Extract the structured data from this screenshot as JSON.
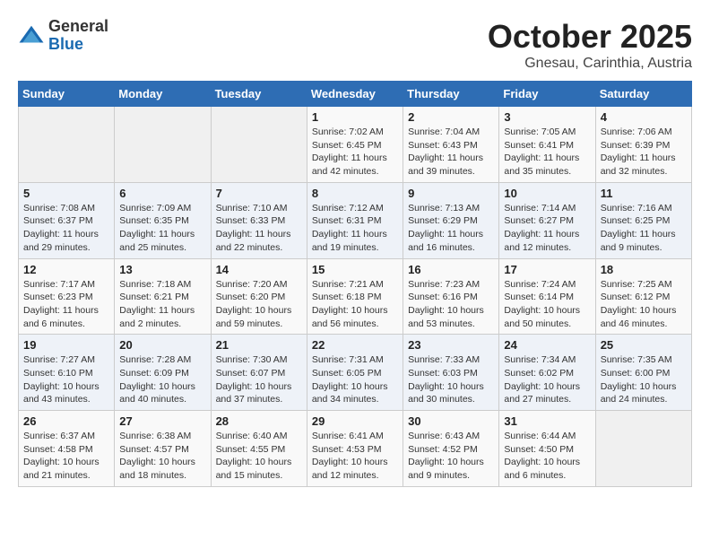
{
  "logo": {
    "general": "General",
    "blue": "Blue"
  },
  "header": {
    "month": "October 2025",
    "location": "Gnesau, Carinthia, Austria"
  },
  "days_of_week": [
    "Sunday",
    "Monday",
    "Tuesday",
    "Wednesday",
    "Thursday",
    "Friday",
    "Saturday"
  ],
  "weeks": [
    [
      {
        "day": "",
        "info": ""
      },
      {
        "day": "",
        "info": ""
      },
      {
        "day": "",
        "info": ""
      },
      {
        "day": "1",
        "info": "Sunrise: 7:02 AM\nSunset: 6:45 PM\nDaylight: 11 hours and 42 minutes."
      },
      {
        "day": "2",
        "info": "Sunrise: 7:04 AM\nSunset: 6:43 PM\nDaylight: 11 hours and 39 minutes."
      },
      {
        "day": "3",
        "info": "Sunrise: 7:05 AM\nSunset: 6:41 PM\nDaylight: 11 hours and 35 minutes."
      },
      {
        "day": "4",
        "info": "Sunrise: 7:06 AM\nSunset: 6:39 PM\nDaylight: 11 hours and 32 minutes."
      }
    ],
    [
      {
        "day": "5",
        "info": "Sunrise: 7:08 AM\nSunset: 6:37 PM\nDaylight: 11 hours and 29 minutes."
      },
      {
        "day": "6",
        "info": "Sunrise: 7:09 AM\nSunset: 6:35 PM\nDaylight: 11 hours and 25 minutes."
      },
      {
        "day": "7",
        "info": "Sunrise: 7:10 AM\nSunset: 6:33 PM\nDaylight: 11 hours and 22 minutes."
      },
      {
        "day": "8",
        "info": "Sunrise: 7:12 AM\nSunset: 6:31 PM\nDaylight: 11 hours and 19 minutes."
      },
      {
        "day": "9",
        "info": "Sunrise: 7:13 AM\nSunset: 6:29 PM\nDaylight: 11 hours and 16 minutes."
      },
      {
        "day": "10",
        "info": "Sunrise: 7:14 AM\nSunset: 6:27 PM\nDaylight: 11 hours and 12 minutes."
      },
      {
        "day": "11",
        "info": "Sunrise: 7:16 AM\nSunset: 6:25 PM\nDaylight: 11 hours and 9 minutes."
      }
    ],
    [
      {
        "day": "12",
        "info": "Sunrise: 7:17 AM\nSunset: 6:23 PM\nDaylight: 11 hours and 6 minutes."
      },
      {
        "day": "13",
        "info": "Sunrise: 7:18 AM\nSunset: 6:21 PM\nDaylight: 11 hours and 2 minutes."
      },
      {
        "day": "14",
        "info": "Sunrise: 7:20 AM\nSunset: 6:20 PM\nDaylight: 10 hours and 59 minutes."
      },
      {
        "day": "15",
        "info": "Sunrise: 7:21 AM\nSunset: 6:18 PM\nDaylight: 10 hours and 56 minutes."
      },
      {
        "day": "16",
        "info": "Sunrise: 7:23 AM\nSunset: 6:16 PM\nDaylight: 10 hours and 53 minutes."
      },
      {
        "day": "17",
        "info": "Sunrise: 7:24 AM\nSunset: 6:14 PM\nDaylight: 10 hours and 50 minutes."
      },
      {
        "day": "18",
        "info": "Sunrise: 7:25 AM\nSunset: 6:12 PM\nDaylight: 10 hours and 46 minutes."
      }
    ],
    [
      {
        "day": "19",
        "info": "Sunrise: 7:27 AM\nSunset: 6:10 PM\nDaylight: 10 hours and 43 minutes."
      },
      {
        "day": "20",
        "info": "Sunrise: 7:28 AM\nSunset: 6:09 PM\nDaylight: 10 hours and 40 minutes."
      },
      {
        "day": "21",
        "info": "Sunrise: 7:30 AM\nSunset: 6:07 PM\nDaylight: 10 hours and 37 minutes."
      },
      {
        "day": "22",
        "info": "Sunrise: 7:31 AM\nSunset: 6:05 PM\nDaylight: 10 hours and 34 minutes."
      },
      {
        "day": "23",
        "info": "Sunrise: 7:33 AM\nSunset: 6:03 PM\nDaylight: 10 hours and 30 minutes."
      },
      {
        "day": "24",
        "info": "Sunrise: 7:34 AM\nSunset: 6:02 PM\nDaylight: 10 hours and 27 minutes."
      },
      {
        "day": "25",
        "info": "Sunrise: 7:35 AM\nSunset: 6:00 PM\nDaylight: 10 hours and 24 minutes."
      }
    ],
    [
      {
        "day": "26",
        "info": "Sunrise: 6:37 AM\nSunset: 4:58 PM\nDaylight: 10 hours and 21 minutes."
      },
      {
        "day": "27",
        "info": "Sunrise: 6:38 AM\nSunset: 4:57 PM\nDaylight: 10 hours and 18 minutes."
      },
      {
        "day": "28",
        "info": "Sunrise: 6:40 AM\nSunset: 4:55 PM\nDaylight: 10 hours and 15 minutes."
      },
      {
        "day": "29",
        "info": "Sunrise: 6:41 AM\nSunset: 4:53 PM\nDaylight: 10 hours and 12 minutes."
      },
      {
        "day": "30",
        "info": "Sunrise: 6:43 AM\nSunset: 4:52 PM\nDaylight: 10 hours and 9 minutes."
      },
      {
        "day": "31",
        "info": "Sunrise: 6:44 AM\nSunset: 4:50 PM\nDaylight: 10 hours and 6 minutes."
      },
      {
        "day": "",
        "info": ""
      }
    ]
  ]
}
